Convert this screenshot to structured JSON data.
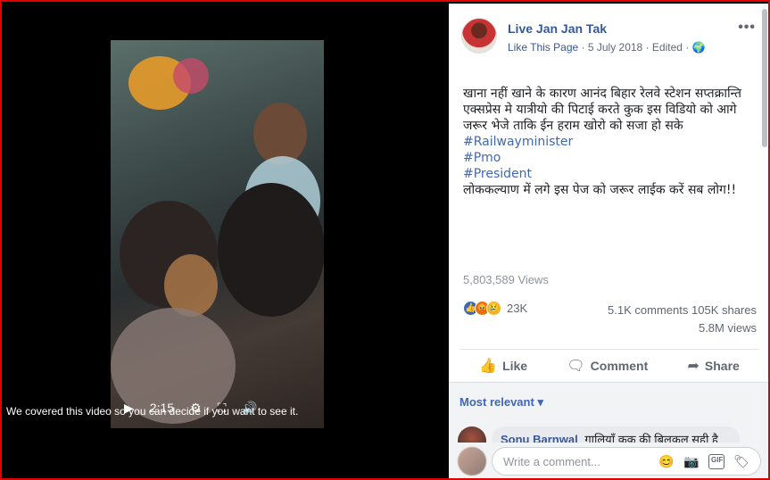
{
  "video": {
    "caption": "We covered this video so you can decide if you want to see it.",
    "time": "2:15",
    "icons": {
      "play": "play-icon",
      "volume": "volume-icon",
      "settings": "gear-icon",
      "fullscreen": "fullscreen-icon"
    },
    "glyphs": {
      "play": "▶",
      "settings": "⚙",
      "fullscreen": "⛶",
      "volume": "🔊"
    }
  },
  "post": {
    "page_name": "Live Jan Jan Tak",
    "like_page": "Like This Page",
    "date": "5 July 2018",
    "edited": "Edited",
    "separator": " · ",
    "globe": "🌍",
    "more": "•••",
    "text_lines": [
      "खाना नहीं खाने के कारण आनंद बिहार रेलवे स्टेशन सप्तक्रान्ति एक्सप्रेस मे यात्रीयो की पिटाई करते कुक इस विडियो को आगे जरूर भेजे ताकि ईन हराम खोरो को सजा हो सके"
    ],
    "hashtags": [
      "#Railwayminister",
      "#Pmo",
      "#President"
    ],
    "closing_line": "लोककल्याण में लगे इस पेज को जरूर लाईक करें सब लोग!!",
    "views_label": "5,803,589 Views",
    "reaction_count": "23K",
    "comments_count": "5.1K comments",
    "shares_count": "105K shares",
    "views_short": "5.8M views",
    "reactions": [
      {
        "name": "like-reaction-icon",
        "glyph": "👍",
        "color": "#4267b2"
      },
      {
        "name": "angry-reaction-icon",
        "glyph": "😡",
        "color": "#e9710f"
      },
      {
        "name": "sad-reaction-icon",
        "glyph": "😢",
        "color": "#f7b125"
      }
    ]
  },
  "actions": {
    "like": "Like",
    "comment": "Comment",
    "share": "Share",
    "like_glyph": "👍",
    "comment_glyph": "🗨",
    "share_glyph": "➦"
  },
  "comments": {
    "sort_label": "Most relevant",
    "sort_arrow": "▾",
    "first_author": "Sonu Barnwal",
    "first_text": "गालियाँ कुक की बिलकुल सही है",
    "write_placeholder": "Write a comment...",
    "write_icons": [
      "😊",
      "📷",
      "GIF",
      "🏷"
    ]
  },
  "colors": {
    "frame_border": "#e00000",
    "link_blue": "#365899",
    "hashtag_blue": "#4267b2"
  }
}
